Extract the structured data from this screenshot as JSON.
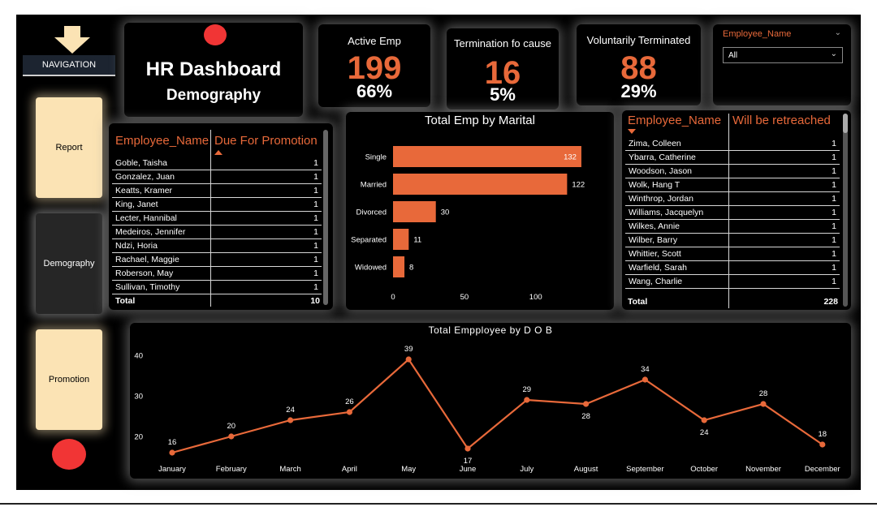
{
  "navigation": {
    "label": "NAVIGATION",
    "buttons": [
      "Report",
      "Demography",
      "Promotion"
    ]
  },
  "title": {
    "main": "HR Dashboard",
    "sub": "Demography"
  },
  "kpis": [
    {
      "title": "Active Emp",
      "value": "199",
      "pct": "66%"
    },
    {
      "title": "Termination fo cause",
      "value": "16",
      "pct": "5%"
    },
    {
      "title": "Voluntarily Terminated",
      "value": "88",
      "pct": "29%"
    }
  ],
  "slicer": {
    "title": "Employee_Name",
    "selected": "All"
  },
  "promotion_table": {
    "headers": [
      "Employee_Name",
      "Due For Promotion"
    ],
    "rows": [
      [
        "Goble, Taisha",
        "1"
      ],
      [
        "Gonzalez, Juan",
        "1"
      ],
      [
        "Keatts, Kramer",
        "1"
      ],
      [
        "King, Janet",
        "1"
      ],
      [
        "Lecter, Hannibal",
        "1"
      ],
      [
        "Medeiros, Jennifer",
        "1"
      ],
      [
        "Ndzi, Horia",
        "1"
      ],
      [
        "Rachael, Maggie",
        "1"
      ],
      [
        "Roberson, May",
        "1"
      ],
      [
        "Sullivan, Timothy",
        "1"
      ]
    ],
    "total_label": "Total",
    "total_value": "10"
  },
  "retreach_table": {
    "headers": [
      "Employee_Name",
      "Will be retreached"
    ],
    "rows": [
      [
        "Zima, Colleen",
        "1"
      ],
      [
        "Ybarra, Catherine",
        "1"
      ],
      [
        "Woodson, Jason",
        "1"
      ],
      [
        "Wolk, Hang T",
        "1"
      ],
      [
        "Winthrop, Jordan",
        "1"
      ],
      [
        "Williams, Jacquelyn",
        "1"
      ],
      [
        "Wilkes, Annie",
        "1"
      ],
      [
        "Wilber, Barry",
        "1"
      ],
      [
        "Whittier, Scott",
        "1"
      ],
      [
        "Warfield, Sarah",
        "1"
      ],
      [
        "Wang, Charlie",
        "1"
      ]
    ],
    "total_label": "Total",
    "total_value": "228"
  },
  "colors": {
    "accent": "#e8693a",
    "background": "#000000",
    "nav_light": "#fbe3b4",
    "dot": "#f13535"
  },
  "chart_data": [
    {
      "type": "bar",
      "orientation": "horizontal",
      "title": "Total Emp by Marital",
      "categories": [
        "Single",
        "Married",
        "Divorced",
        "Separated",
        "Widowed"
      ],
      "values": [
        132,
        122,
        30,
        11,
        8
      ],
      "xticks": [
        0,
        50,
        100
      ],
      "xlim": [
        0,
        140
      ]
    },
    {
      "type": "line",
      "title": "Total Empployee by D O B",
      "categories": [
        "January",
        "February",
        "March",
        "April",
        "May",
        "June",
        "July",
        "August",
        "September",
        "October",
        "November",
        "December"
      ],
      "values": [
        16,
        20,
        24,
        26,
        39,
        17,
        29,
        28,
        34,
        24,
        28,
        18
      ],
      "yticks": [
        20,
        30,
        40
      ],
      "ylim": [
        14,
        42
      ]
    }
  ]
}
